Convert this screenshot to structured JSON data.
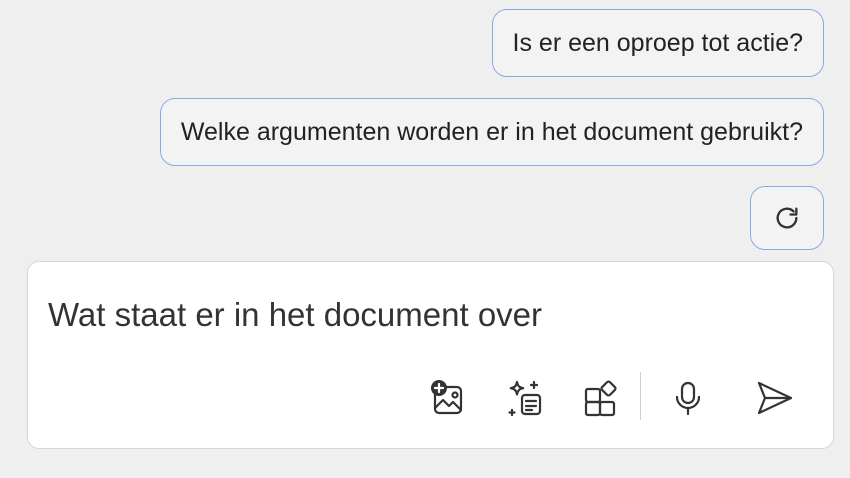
{
  "suggestions": [
    {
      "label": "Is er een oproep tot actie?"
    },
    {
      "label": "Welke argumenten worden er in het document gebruikt?"
    }
  ],
  "refresh": {
    "icon": "refresh-icon"
  },
  "composer": {
    "value": "Wat staat er in het document over",
    "tools": [
      {
        "icon": "add-image-icon"
      },
      {
        "icon": "ai-notes-icon"
      },
      {
        "icon": "apps-icon"
      },
      {
        "icon": "microphone-icon"
      },
      {
        "icon": "send-icon"
      }
    ]
  },
  "colors": {
    "background": "#efefef",
    "accent_border": "#8aa9e8",
    "composer_bg": "#ffffff",
    "text": "#222222"
  }
}
